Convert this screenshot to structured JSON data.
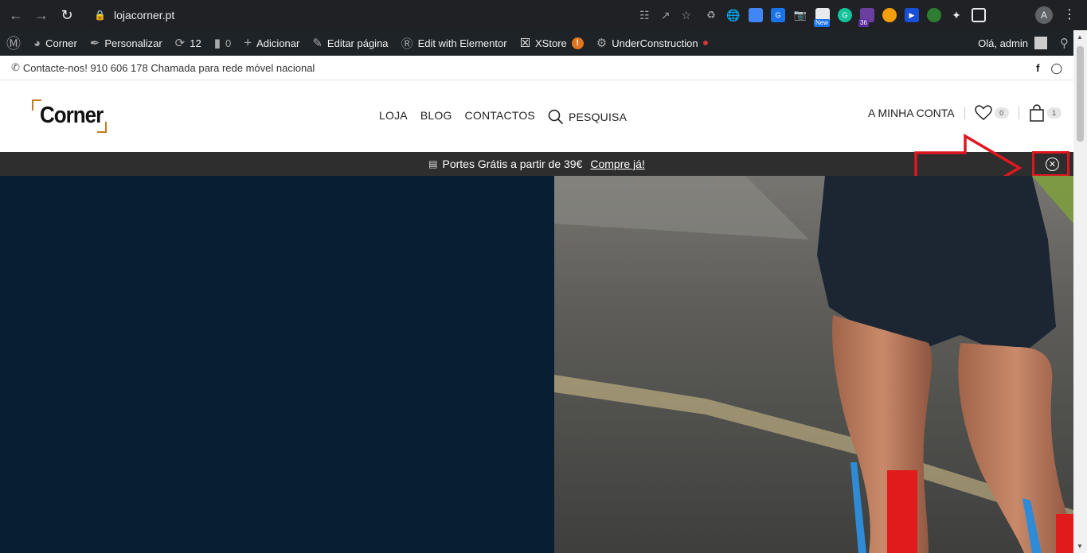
{
  "browser": {
    "url": "lojacorner.pt",
    "avatar_letter": "A",
    "new_badge": "New",
    "ext_count_badge": "36"
  },
  "admin_bar": {
    "site_name": "Corner",
    "customize": "Personalizar",
    "updates_count": "12",
    "comments_count": "0",
    "add_new": "Adicionar",
    "edit_page": "Editar página",
    "elementor": "Edit with Elementor",
    "xstore": "XStore",
    "xstore_alert": "!",
    "under_construction": "UnderConstruction",
    "greeting": "Olá, admin"
  },
  "topbar": {
    "contact": "Contacte-nos! 910 606 178 Chamada para rede móvel nacional"
  },
  "header": {
    "logo": "Corner",
    "nav": [
      "LOJA",
      "BLOG",
      "CONTACTOS",
      "PESQUISA"
    ],
    "account": "A MINHA CONTA",
    "wishlist_count": "0",
    "cart_count": "1"
  },
  "promo": {
    "text": "Portes Grátis a partir de 39€",
    "cta": "Compre já!"
  },
  "colors": {
    "hero_bg": "#071f31",
    "accent": "#c8791d",
    "highlight": "#e0161f"
  }
}
